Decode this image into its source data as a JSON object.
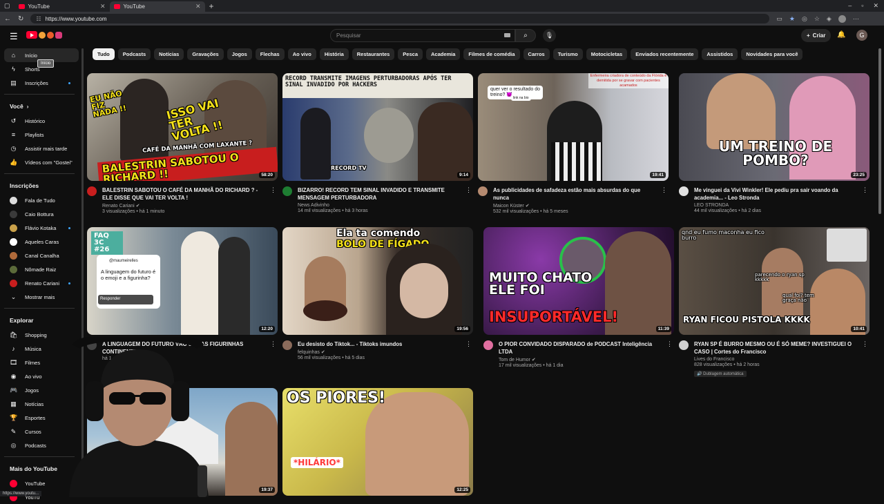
{
  "browser": {
    "tabs": [
      {
        "label": "YouTube"
      },
      {
        "label": "YouTube"
      }
    ],
    "url": "https://www.youtube.com",
    "status_url": "https://www.youtu..."
  },
  "header": {
    "search_placeholder": "Pesquisar",
    "create_label": "Criar",
    "avatar_letter": "G"
  },
  "chips": [
    "Tudo",
    "Podcasts",
    "Notícias",
    "Gravações",
    "Jogos",
    "Flechas",
    "Ao vivo",
    "História",
    "Restaurantes",
    "Pesca",
    "Academia",
    "Filmes de comédia",
    "Carros",
    "Turismo",
    "Motocicletas",
    "Enviados recentemente",
    "Assistidos",
    "Novidades para você"
  ],
  "sidebar": {
    "main": [
      {
        "label": "Início",
        "icon": "home-icon"
      },
      {
        "label": "Shorts",
        "icon": "shorts-icon"
      },
      {
        "label": "Inscrições",
        "icon": "subscriptions-icon"
      }
    ],
    "tooltip": "Início",
    "you_heading": "Você",
    "you": [
      {
        "label": "Histórico",
        "icon": "history-icon"
      },
      {
        "label": "Playlists",
        "icon": "playlists-icon"
      },
      {
        "label": "Assistir mais tarde",
        "icon": "watch-later-icon"
      },
      {
        "label": "Vídeos com \"Gostei\"",
        "icon": "like-icon"
      }
    ],
    "subs_heading": "Inscrições",
    "subs": [
      {
        "label": "Fala de Tudo",
        "color": "#dcdcdc",
        "dot": false
      },
      {
        "label": "Caio Bottura",
        "color": "#3a3a3a",
        "dot": false
      },
      {
        "label": "Flávio Kotaka",
        "color": "#c9a14a",
        "dot": true
      },
      {
        "label": "Aqueles Caras",
        "color": "#ffffff",
        "dot": false
      },
      {
        "label": "Canal Canalha",
        "color": "#b06a3a",
        "dot": false
      },
      {
        "label": "Nômade Raiz",
        "color": "#5c6b3a",
        "dot": false
      },
      {
        "label": "Renato Cariani",
        "color": "#c81e1e",
        "dot": true
      }
    ],
    "show_more": "Mostrar mais",
    "explore_heading": "Explorar",
    "explore": [
      {
        "label": "Shopping",
        "icon": "shopping-icon"
      },
      {
        "label": "Música",
        "icon": "music-icon"
      },
      {
        "label": "Filmes",
        "icon": "movies-icon"
      },
      {
        "label": "Ao vivo",
        "icon": "live-icon"
      },
      {
        "label": "Jogos",
        "icon": "gaming-icon"
      },
      {
        "label": "Notícias",
        "icon": "news-icon"
      },
      {
        "label": "Esportes",
        "icon": "sports-icon"
      },
      {
        "label": "Cursos",
        "icon": "courses-icon"
      },
      {
        "label": "Podcasts",
        "icon": "podcasts-icon"
      }
    ],
    "more_heading": "Mais do YouTube",
    "more": [
      {
        "label": "YouTube",
        "icon": "youtube-premium-icon"
      },
      {
        "label": "YouTu",
        "icon": "youtube-music-icon"
      }
    ]
  },
  "videos": [
    {
      "title": "BALESTRIN SABOTOU O CAFÉ DA MANHÃ DO RICHARD ? - ELE DISSE QUE VAI TER VOLTA !",
      "channel": "Renato Cariani",
      "verified": true,
      "stats": "3 visualizações • há 1 minuto",
      "duration": "58:20",
      "bg": "#7a6a55",
      "ava": "#c81e1e"
    },
    {
      "title": "BIZARRO! RECORD TEM SINAL INVADIDO E TRANSMITE MENSAGEM PERTURBADORA",
      "channel": "News Adivinho",
      "verified": false,
      "stats": "14 mil visualizações • há 3 horas",
      "duration": "9:14",
      "bg": "#4a4a52",
      "ava": "#1e7d32"
    },
    {
      "title": "As publicidades de safadeza estão mais absurdas do que nunca",
      "channel": "Maicon Küster",
      "verified": true,
      "stats": "532 mil visualizações • há 5 meses",
      "duration": "19:41",
      "bg": "#8a8378",
      "ava": "#b58a70"
    },
    {
      "title": "Me vinguei da Vivi Winkler! Ele pediu pra sair voando da academia... - Leo Stronda",
      "channel": "LEO STRONDA",
      "verified": false,
      "stats": "44 mil visualizações • há 2 dias",
      "duration": "23:25",
      "bg": "#5a5a66",
      "ava": "#e0e0e0"
    },
    {
      "title": "A LINGUAGEM DO FUTURO VÃO SER AS FIGURINHAS CONTINENTES",
      "channel": "",
      "verified": false,
      "stats": "há 1 dia",
      "duration": "12:20",
      "bg": "#6c7a86",
      "ava": "#444"
    },
    {
      "title": "Eu desisto do Tiktok... - Tiktoks imundos",
      "channel": "felquinhas",
      "verified": true,
      "stats": "56 mil visualizações • há 5 dias",
      "duration": "19:56",
      "bg": "#8f7a62",
      "ava": "#8b6b5b"
    },
    {
      "title": "O PIOR CONVIDADO DISPARADO de PODCAST Inteligência LTDA",
      "channel": "Tom de Humor",
      "verified": true,
      "stats": "17 mil visualizações • há 1 dia",
      "duration": "11:39",
      "bg": "#5a2a6a",
      "ava": "#e06fa0"
    },
    {
      "title": "RYAN SP É BURRO MESMO OU É SÓ MEME? INVESTIGUEI O CASO | Cortes do Francisco",
      "channel": "Lives do Francisco",
      "verified": false,
      "stats": "828 visualizações • há 2 horas",
      "duration": "10:41",
      "bg": "#4e4a44",
      "ava": "#cfcfcf",
      "badge": "Dublagem automática"
    },
    {
      "title": "",
      "channel": "",
      "verified": false,
      "stats": "",
      "duration": "19:37",
      "bg": "#6d8fb0",
      "ava": "#333"
    },
    {
      "title": "",
      "channel": "",
      "verified": false,
      "stats": "",
      "duration": "12:25",
      "bg": "#d8c95a",
      "ava": "#333"
    }
  ],
  "thumb_text": {
    "v1a": "EU NÃO FIZ NADA !!",
    "v1b": "ISSO VAI TER VOLTA !!",
    "v1c": "CAFÉ DA MANHÃ COM LAXANTE ?",
    "v1d": "BALESTRIN SABOTOU O RICHARD !!",
    "v2a": "RECORD TRANSMITE IMAGENS PERTURBADORAS APÓS TER SINAL INVADIDO POR HACKERS",
    "v2b": "RECORD TV",
    "v3a": "quer ver o resultado do treino? 😈",
    "v3b": "link na bio",
    "v3c": "Enfermeira criadora de conteúdo da Flórida é demitida por se gravar com pacientes acamados",
    "v4a": "UM TREINO DE POMBO?",
    "v5a": "FAQ 3C #26",
    "v5b": "@maumeirelles",
    "v5c": "A linguagem do futuro é o emoji e a figurinha?",
    "v5d": "Responder",
    "v6a": "Ela ta comendo",
    "v6b": "BOLO DE FÍGADO",
    "v7a": "MUITO CHATO ELE FOI",
    "v7b": "INSUPORTÁVEL!",
    "v8a": "qnd eu fumo maconha eu fico burro",
    "v8b": "parecendo o ryan sp kkkkk",
    "v8c": "qual foi? tem graça não",
    "v8d": "RYAN FICOU PISTOLA KKKK",
    "v10a": "OS PIORES!",
    "v10b": "*HILÁRIO*"
  }
}
